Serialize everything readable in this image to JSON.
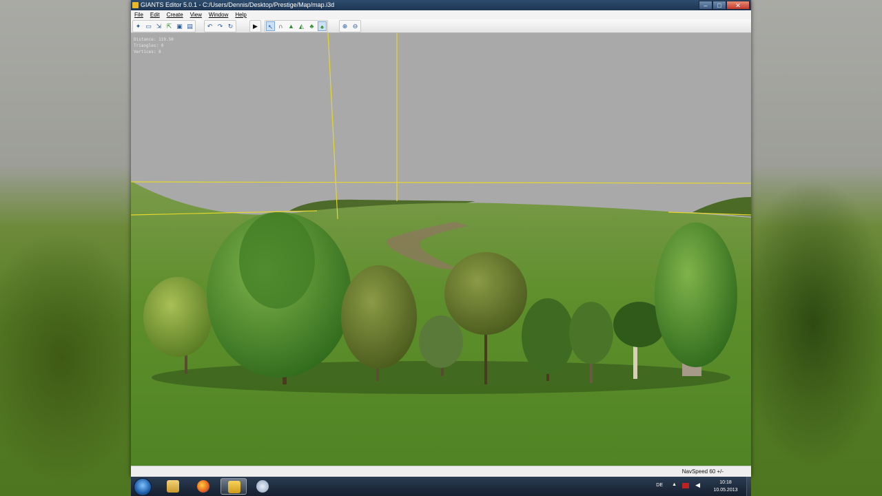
{
  "window": {
    "title": "GIANTS Editor 5.0.1 - C:/Users/Dennis/Desktop/Prestige/Map/map.i3d",
    "controls": {
      "minimize": "–",
      "maximize": "□",
      "close": "✕"
    }
  },
  "menu": {
    "items": [
      {
        "label": "File"
      },
      {
        "label": "Edit"
      },
      {
        "label": "Create"
      },
      {
        "label": "View"
      },
      {
        "label": "Window"
      },
      {
        "label": "Help"
      }
    ]
  },
  "toolbar": {
    "icons": [
      "new-icon",
      "open-icon",
      "import-icon",
      "export-icon",
      "save-icon",
      "save-as-icon",
      "undo-icon",
      "redo-icon",
      "redo-all-icon",
      "play-icon",
      "select-icon",
      "move-icon",
      "terrain-icon",
      "paint-icon",
      "foliage-icon",
      "foliage-paint-icon",
      "zoom-in-icon",
      "zoom-out-icon"
    ]
  },
  "viewport": {
    "stats": {
      "line1": "Distance: 119.50",
      "line2": "Triangles: 0",
      "line3": "Vertices: 0"
    },
    "guide_color": "#e6d82a",
    "sky_color": "#a9a9a9",
    "grass_color": "#5f8f2c"
  },
  "statusbar": {
    "navspeed": "NavSpeed 60 +/-"
  },
  "taskbar": {
    "tray": {
      "lang": "DE",
      "arrow": "▲",
      "time": "10:18",
      "date": "10.05.2013"
    }
  }
}
